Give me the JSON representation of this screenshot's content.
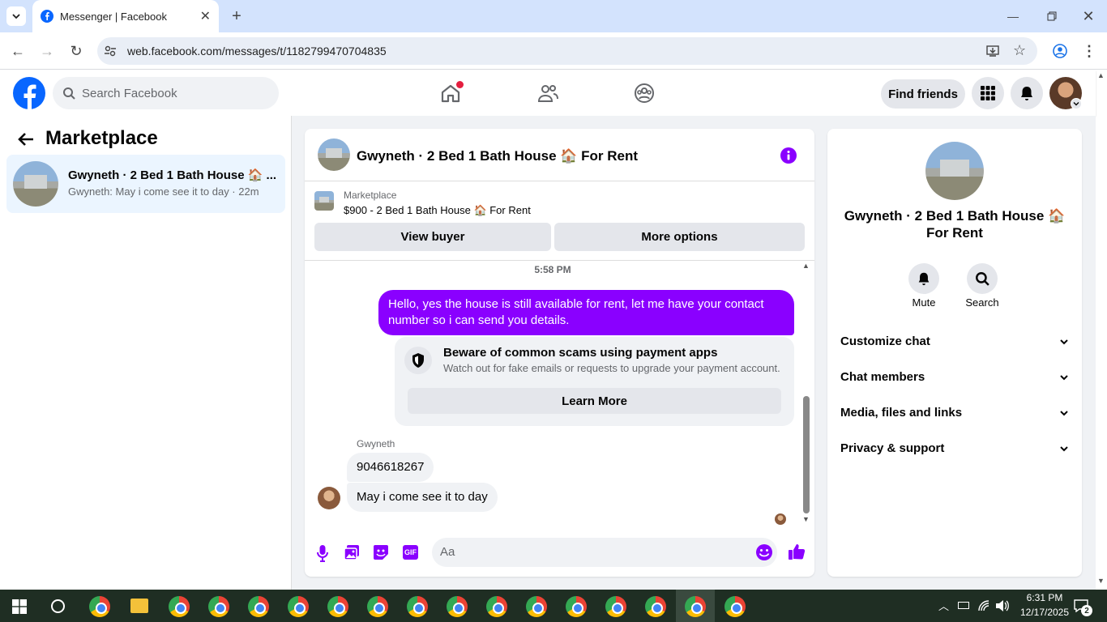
{
  "browser": {
    "tab_title": "Messenger | Facebook",
    "url": "web.facebook.com/messages/t/1182799470704835"
  },
  "header": {
    "search_placeholder": "Search Facebook",
    "find_friends": "Find friends"
  },
  "left": {
    "title": "Marketplace",
    "conversation": {
      "title": "Gwyneth · 2 Bed 1 Bath House 🏠 ...",
      "preview": "Gwyneth: May i come see it to day · 22m"
    }
  },
  "chat": {
    "title": "Gwyneth · 2 Bed 1 Bath House 🏠 For Rent",
    "listing_label": "Marketplace",
    "listing_text": "$900 - 2 Bed 1 Bath House 🏠 For Rent",
    "view_buyer": "View buyer",
    "more_options": "More options",
    "timestamp": "5:58 PM",
    "outgoing": "Hello, yes the house is still available for rent, let me have your contact number so i can send you  details.",
    "warning_title": "Beware of common scams using payment apps",
    "warning_text": "Watch out for fake emails or requests to upgrade your payment account.",
    "learn_more": "Learn More",
    "sender": "Gwyneth",
    "incoming1": "9046618267",
    "incoming2": "May i come see it to day",
    "input_placeholder": "Aa"
  },
  "details": {
    "name": "Gwyneth · 2 Bed 1 Bath House 🏠 For Rent",
    "mute": "Mute",
    "search": "Search",
    "sections": [
      "Customize chat",
      "Chat members",
      "Media, files and links",
      "Privacy & support"
    ]
  },
  "taskbar": {
    "time": "6:31 PM",
    "date": "12/17/2025",
    "notif_count": "2"
  },
  "colors": {
    "fb_blue": "#0866ff",
    "purple": "#8a00ff"
  }
}
